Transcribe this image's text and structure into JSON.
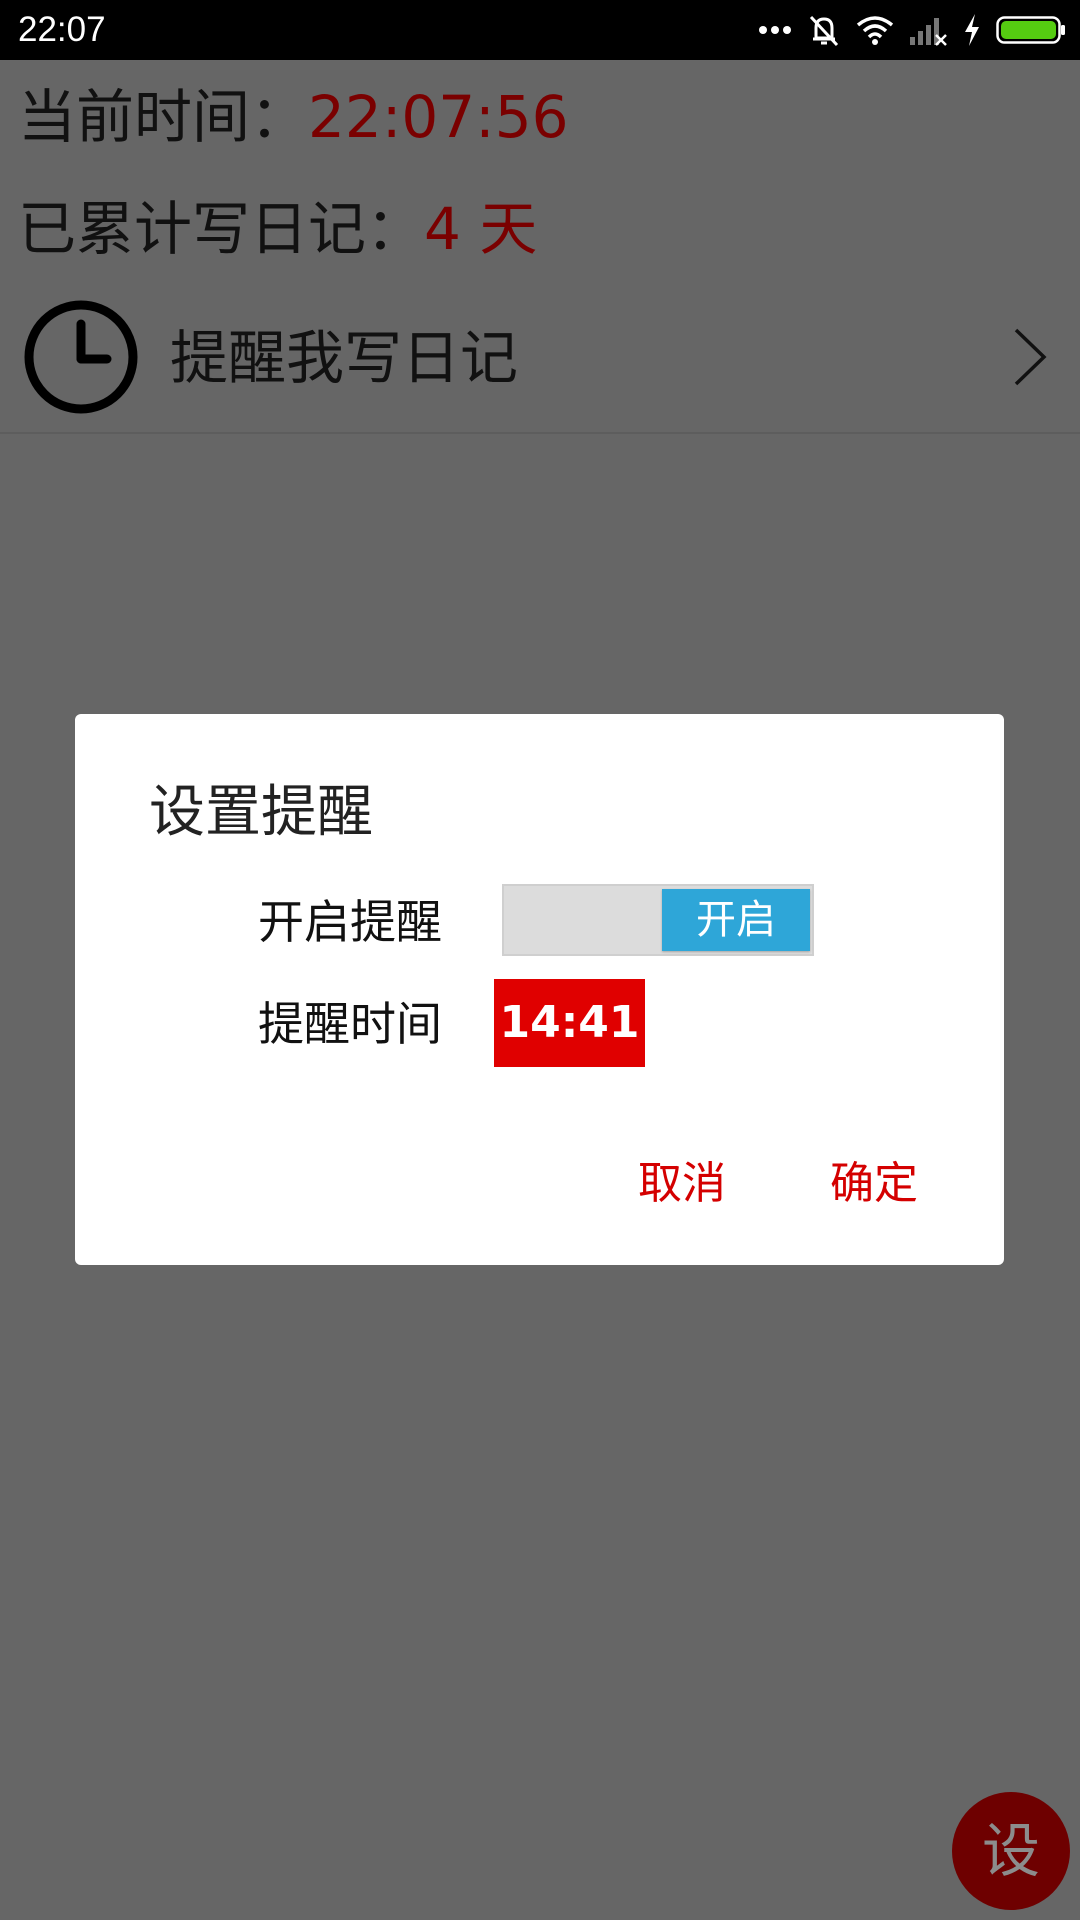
{
  "status_bar": {
    "time": "22:07",
    "icons": [
      "more-dots-icon",
      "vibrate-off-icon",
      "wifi-icon",
      "no-signal-icon",
      "charging-icon",
      "battery-icon"
    ],
    "battery_color": "#55cc11"
  },
  "page": {
    "current_time_label": "当前时间：",
    "current_time_value": "22:07:56",
    "days_label": "已累计写日记：",
    "days_value": "4 天",
    "reminder_row_label": "提醒我写日记",
    "value_color": "#7a0000"
  },
  "dialog": {
    "title": "设置提醒",
    "enable_label": "开启提醒",
    "toggle_text": "开启",
    "toggle_on": true,
    "time_label": "提醒时间",
    "time_value": "14:41",
    "cancel_label": "取消",
    "ok_label": "确定",
    "accent_color": "#d40000",
    "toggle_color": "#2ea6d8"
  },
  "fab": {
    "label": "设"
  }
}
